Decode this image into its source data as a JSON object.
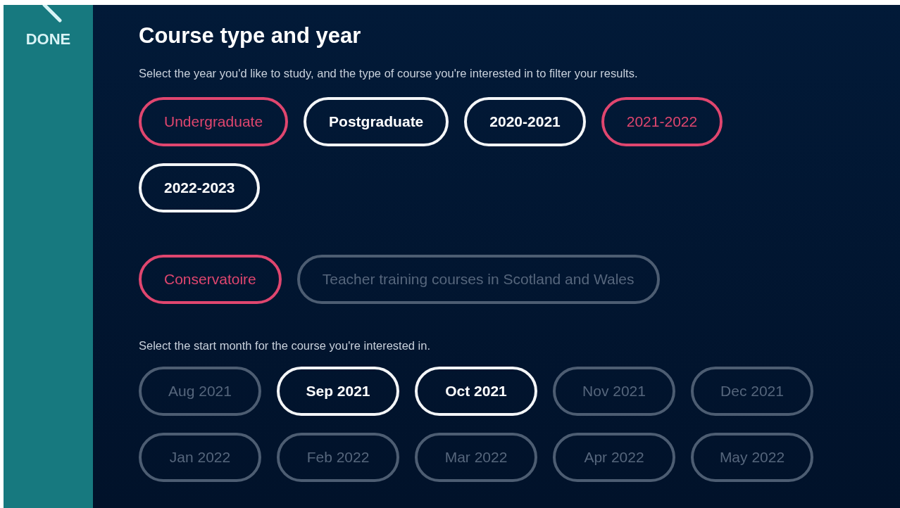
{
  "sidebar": {
    "done_label": "DONE"
  },
  "section": {
    "title": "Course type and year",
    "description": "Select the year you'd like to study, and the type of course you're interested in to filter your results."
  },
  "year_chips": [
    {
      "label": "Undergraduate",
      "selected": true,
      "disabled": false
    },
    {
      "label": "Postgraduate",
      "selected": false,
      "disabled": false
    },
    {
      "label": "2020-2021",
      "selected": false,
      "disabled": false
    },
    {
      "label": "2021-2022",
      "selected": true,
      "disabled": false
    },
    {
      "label": "2022-2023",
      "selected": false,
      "disabled": false
    }
  ],
  "type_chips": [
    {
      "label": "Conservatoire",
      "selected": true,
      "disabled": false
    },
    {
      "label": "Teacher training courses in Scotland and Wales",
      "selected": false,
      "disabled": true
    }
  ],
  "month_prompt": "Select the start month for the course you're interested in.",
  "month_chips": [
    {
      "label": "Aug 2021",
      "selected": false,
      "disabled": true
    },
    {
      "label": "Sep 2021",
      "selected": false,
      "disabled": false
    },
    {
      "label": "Oct 2021",
      "selected": false,
      "disabled": false
    },
    {
      "label": "Nov 2021",
      "selected": false,
      "disabled": true
    },
    {
      "label": "Dec 2021",
      "selected": false,
      "disabled": true
    },
    {
      "label": "Jan 2022",
      "selected": false,
      "disabled": true
    },
    {
      "label": "Feb 2022",
      "selected": false,
      "disabled": true
    },
    {
      "label": "Mar 2022",
      "selected": false,
      "disabled": true
    },
    {
      "label": "Apr 2022",
      "selected": false,
      "disabled": true
    },
    {
      "label": "May 2022",
      "selected": false,
      "disabled": true
    }
  ]
}
